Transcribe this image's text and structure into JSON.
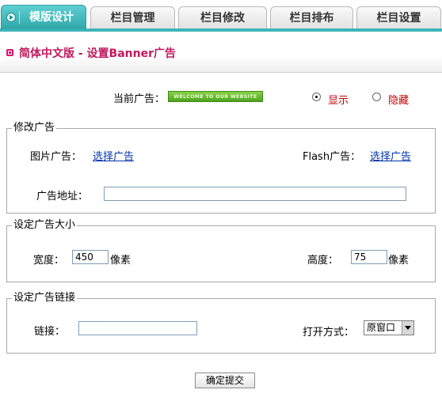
{
  "tabs": [
    {
      "label": "模版设计",
      "active": true
    },
    {
      "label": "栏目管理",
      "active": false
    },
    {
      "label": "栏目修改",
      "active": false
    },
    {
      "label": "栏目排布",
      "active": false
    },
    {
      "label": "栏目设置",
      "active": false
    }
  ],
  "header": {
    "title": "简体中文版 - 设置Banner广告"
  },
  "current_ad": {
    "label": "当前广告：",
    "banner_text": "WELCOME TO OUR WEBSITE",
    "show_label": "显示",
    "hide_label": "隐藏",
    "selected": "显示"
  },
  "modify_ad": {
    "legend": "修改广告",
    "image_label": "图片广告：",
    "image_link": "选择广告",
    "flash_label": "Flash广告：",
    "flash_link": "选择广告",
    "address_label": "广告地址：",
    "address_value": ""
  },
  "size": {
    "legend": "设定广告大小",
    "width_label": "宽度：",
    "width_value": "450",
    "width_unit": "像素",
    "height_label": "高度：",
    "height_value": "75",
    "height_unit": "像素"
  },
  "link": {
    "legend": "设定广告链接",
    "link_label": "链接：",
    "link_value": "",
    "open_label": "打开方式：",
    "open_value": "原窗口"
  },
  "submit_label": "确定提交",
  "colors": {
    "accent": "#3fb5b8",
    "title": "#c2185b",
    "link": "#0033aa",
    "radio_text": "#c00000"
  }
}
